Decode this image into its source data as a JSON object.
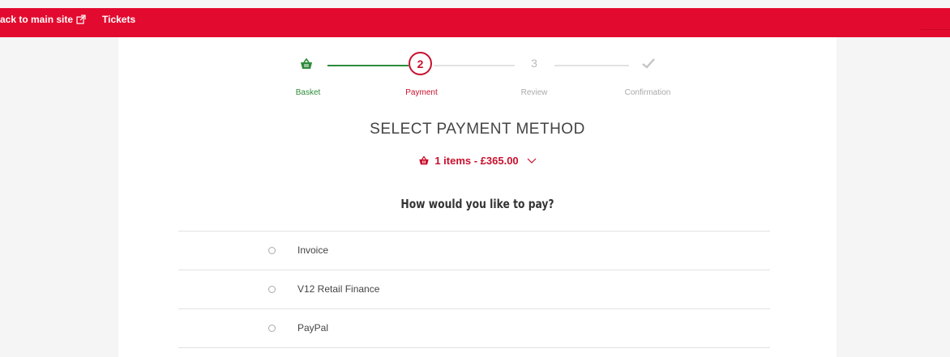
{
  "topbar": {
    "back_label": "ack to main site",
    "tickets_label": "Tickets"
  },
  "stepper": {
    "steps": [
      {
        "label": "Basket",
        "state": "complete",
        "icon": "basket-icon"
      },
      {
        "label": "Payment",
        "state": "active",
        "number": "2"
      },
      {
        "label": "Review",
        "state": "upcoming",
        "number": "3"
      },
      {
        "label": "Confirmation",
        "state": "upcoming",
        "icon": "check-icon"
      }
    ]
  },
  "page_title": "SELECT PAYMENT METHOD",
  "basket_summary": "1 items - £365.00",
  "question": "How would you like to pay?",
  "payment_options": [
    {
      "label": "Invoice"
    },
    {
      "label": "V12 Retail Finance"
    },
    {
      "label": "PayPal"
    }
  ],
  "colors": {
    "brand_red": "#e30a2f",
    "accent_red": "#c8102e",
    "complete_green": "#2e8b3a",
    "inactive_gray": "#bbbbbb"
  }
}
